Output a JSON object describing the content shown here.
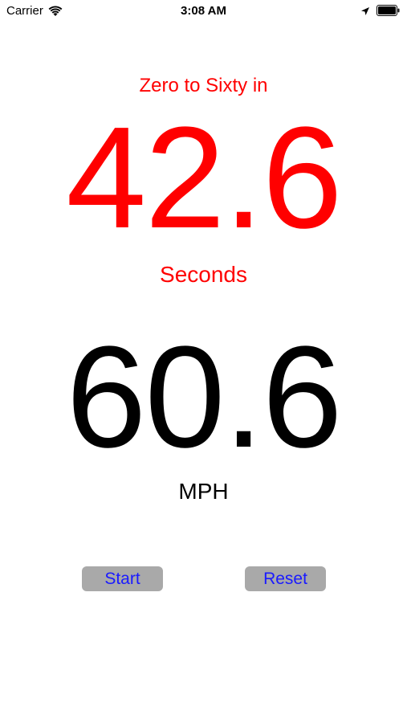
{
  "status_bar": {
    "carrier": "Carrier",
    "time": "3:08 AM",
    "icons": [
      "wifi-icon",
      "location-icon",
      "battery-icon"
    ]
  },
  "main": {
    "heading": "Zero to Sixty in",
    "elapsed_value": "42.6",
    "elapsed_unit": "Seconds",
    "speed_value": "60.6",
    "speed_unit": "MPH"
  },
  "controls": {
    "start_label": "Start",
    "reset_label": "Reset"
  },
  "colors": {
    "accent": "#ff0000",
    "button_bg": "#a9a9a9",
    "button_text": "#1a1aff",
    "text": "#000000"
  }
}
